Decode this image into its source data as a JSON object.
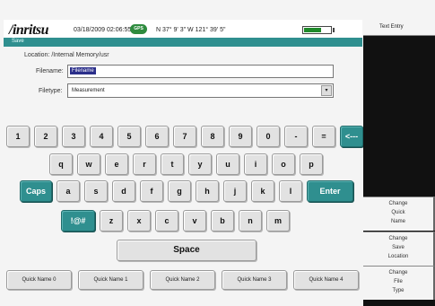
{
  "status": {
    "brand": "/inritsu",
    "datetime": "03/18/2009 02:06:55 pm",
    "gps": "GPS",
    "coords": "N 37° 9' 3\" W 121° 39' 5\"",
    "battery_level": 0.6
  },
  "title": "Save",
  "location_text": "Location: /Internal Memory/usr",
  "filename": {
    "label": "Filename:",
    "value": "Filename"
  },
  "filetype": {
    "label": "Filetype:",
    "value": "Measurement",
    "arrow": "▾"
  },
  "keyboard": {
    "row1": [
      "1",
      "2",
      "3",
      "4",
      "5",
      "6",
      "7",
      "8",
      "9",
      "0",
      "-",
      "=",
      "<---"
    ],
    "row2": [
      "q",
      "w",
      "e",
      "r",
      "t",
      "y",
      "u",
      "i",
      "o",
      "p"
    ],
    "row3": [
      "Caps",
      "a",
      "s",
      "d",
      "f",
      "g",
      "h",
      "j",
      "k",
      "l",
      "Enter"
    ],
    "row4": [
      "!@#",
      "z",
      "x",
      "c",
      "v",
      "b",
      "n",
      "m"
    ],
    "space": "Space"
  },
  "quick_names": [
    "Quick Name 0",
    "Quick Name 1",
    "Quick Name 2",
    "Quick Name 3",
    "Quick Name 4"
  ],
  "softkeys": {
    "title": "Text Entry",
    "items": [
      {
        "lines": [
          "Change",
          "Quick",
          "Name"
        ]
      },
      {
        "lines": [
          "Change",
          "Save",
          "Location"
        ]
      },
      {
        "lines": [
          "Change",
          "File",
          "Type"
        ]
      }
    ]
  },
  "colors": {
    "accent": "#2f8f8f",
    "gps": "#2e8b3e",
    "selection": "#2b2f8a"
  }
}
